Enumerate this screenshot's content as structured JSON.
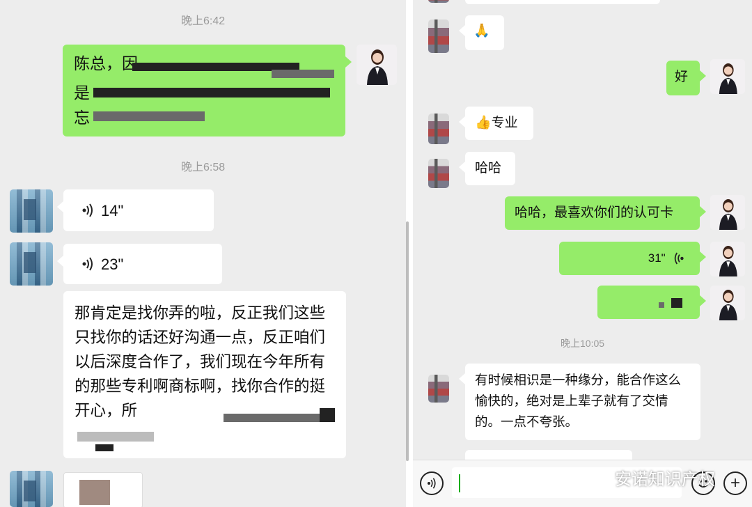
{
  "left": {
    "time1": "晚上6:42",
    "msg_green_partial": "陈总，因",
    "msg_green_line2": "是",
    "msg_green_line3": "忘",
    "time2": "晚上6:58",
    "voice1": "14\"",
    "voice2": "23\"",
    "long_message": "那肯定是找你弄的啦，反正我们这些只找你的话还好沟通一点，反正咱们以后深度合作了，我们现在今年所有的那些专利啊商标啊，找你合作的挺开心，所"
  },
  "right": {
    "emoji_pray": "🙏",
    "reply_good": "好",
    "thumb_text": "专业",
    "thumb_emoji": "👍",
    "haha": "哈哈",
    "reply_long": "哈哈，最喜欢你们的认可卡",
    "voice_sent": "31\"",
    "time3": "晚上10:05",
    "last_message": "有时候相识是一种缘分，能合作这么愉快的，绝对是上辈子就有了交情的。一点不夸张。"
  },
  "watermark": {
    "text": "安诺知识产权"
  },
  "colors": {
    "green_bubble": "#95ec69",
    "white_bubble": "#ffffff",
    "background": "#ededed"
  }
}
